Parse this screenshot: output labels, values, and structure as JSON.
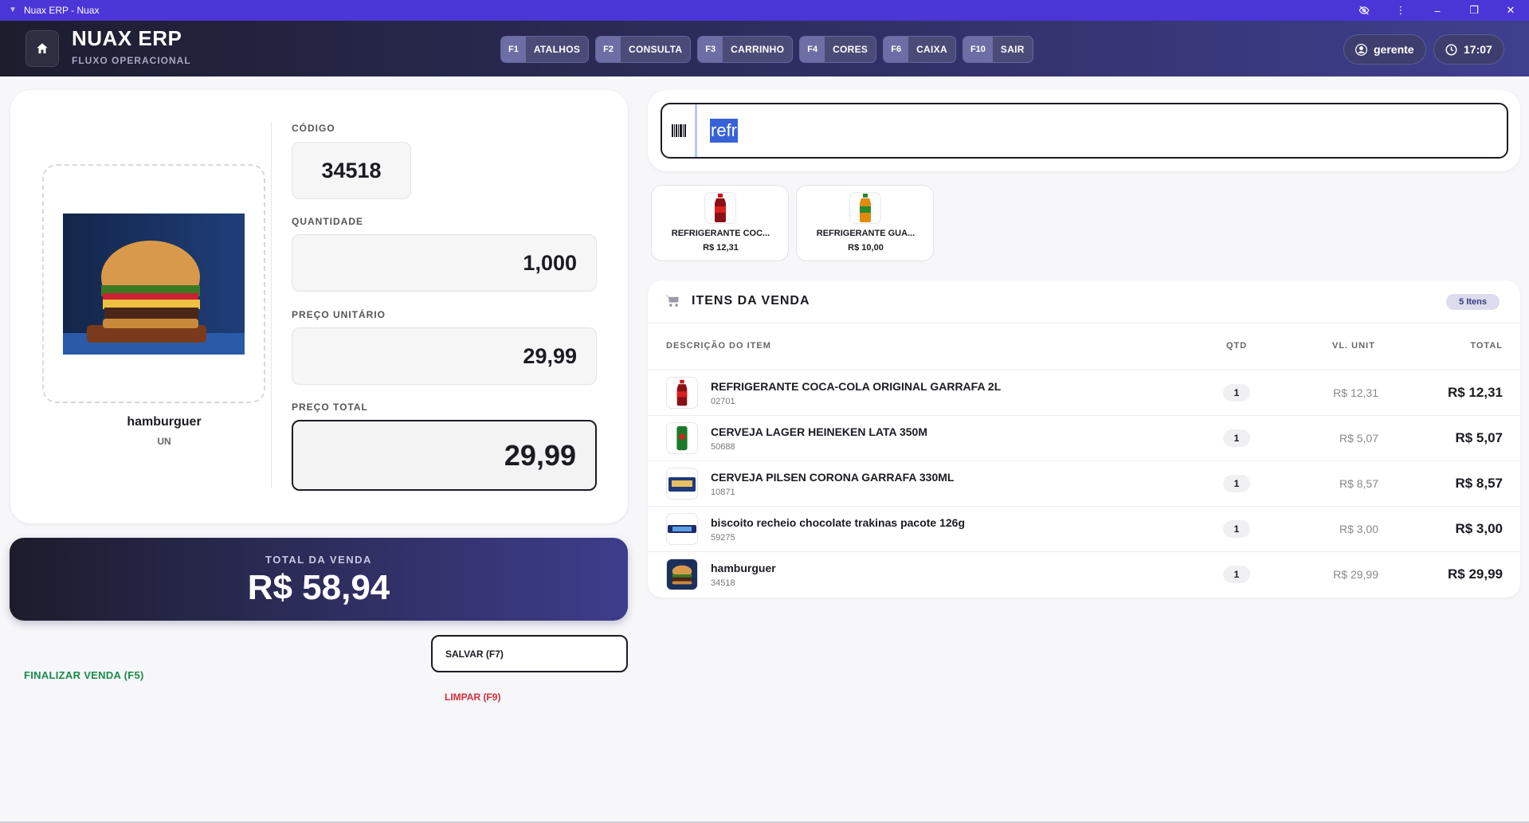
{
  "window": {
    "title": "Nuax ERP - Nuax"
  },
  "header": {
    "brand": "NUAX ERP",
    "subtitle": "FLUXO OPERACIONAL",
    "user": "gerente",
    "time": "17:07"
  },
  "shortcuts": [
    {
      "key": "F1",
      "label": "ATALHOS"
    },
    {
      "key": "F2",
      "label": "CONSULTA"
    },
    {
      "key": "F3",
      "label": "CARRINHO"
    },
    {
      "key": "F4",
      "label": "CORES"
    },
    {
      "key": "F6",
      "label": "CAIXA"
    },
    {
      "key": "F10",
      "label": "SAIR"
    }
  ],
  "product": {
    "name": "hamburguer",
    "unit": "UN",
    "code_label": "CÓDIGO",
    "code": "34518",
    "qty_label": "QUANTIDADE",
    "qty": "1,000",
    "unit_price_label": "PREÇO UNITÁRIO",
    "unit_price": "29,99",
    "total_label": "PREÇO TOTAL",
    "total": "29,99"
  },
  "sale": {
    "label": "TOTAL DA VENDA",
    "value": "R$ 58,94"
  },
  "actions": {
    "finalize": "FINALIZAR VENDA (F5)",
    "save": "SALVAR (F7)",
    "clear": "LIMPAR (F9)"
  },
  "search": {
    "value": "refr"
  },
  "suggestions": [
    {
      "name": "REFRIGERANTE COC...",
      "price": "R$ 12,31"
    },
    {
      "name": "REFRIGERANTE GUA...",
      "price": "R$ 10,00"
    }
  ],
  "items": {
    "title": "ITENS DA VENDA",
    "count": "5 Itens",
    "columns": {
      "desc": "DESCRIÇÃO DO ITEM",
      "qty": "QTD",
      "unit": "VL. UNIT",
      "total": "TOTAL"
    },
    "rows": [
      {
        "name": "REFRIGERANTE COCA-COLA ORIGINAL GARRAFA 2L",
        "code": "02701",
        "qty": "1",
        "unit": "R$ 12,31",
        "total": "R$ 12,31"
      },
      {
        "name": "CERVEJA LAGER HEINEKEN LATA 350M",
        "code": "50688",
        "qty": "1",
        "unit": "R$ 5,07",
        "total": "R$ 5,07"
      },
      {
        "name": "CERVEJA PILSEN CORONA GARRAFA 330ML",
        "code": "10871",
        "qty": "1",
        "unit": "R$ 8,57",
        "total": "R$ 8,57"
      },
      {
        "name": "biscoito recheio chocolate trakinas pacote 126g",
        "code": "59275",
        "qty": "1",
        "unit": "R$ 3,00",
        "total": "R$ 3,00"
      },
      {
        "name": "hamburguer",
        "code": "34518",
        "qty": "1",
        "unit": "R$ 29,99",
        "total": "R$ 29,99"
      }
    ]
  },
  "colors": {
    "titlebar": "#4a36d6",
    "accent": "#3d3d8c",
    "finalize": "#1a8a4a",
    "clear": "#d62b3a"
  }
}
